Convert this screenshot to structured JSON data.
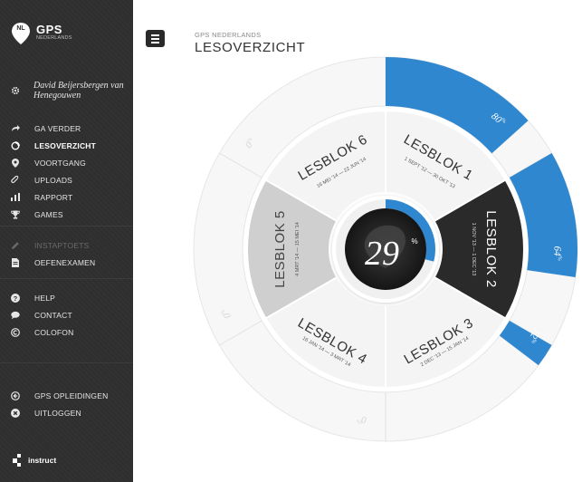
{
  "brand": {
    "badge": "NL",
    "name": "GPS",
    "subtitle": "NEDERLANDS"
  },
  "user": {
    "name": "David Beijersbergen van Henegouwen"
  },
  "nav_main": [
    {
      "label": "GA VERDER",
      "icon": "share-arrow-icon",
      "active": false
    },
    {
      "label": "LESOVERZICHT",
      "icon": "circle-progress-icon",
      "active": true
    },
    {
      "label": "VOORTGANG",
      "icon": "map-pin-icon",
      "active": false
    },
    {
      "label": "UPLOADS",
      "icon": "paperclip-icon",
      "active": false
    },
    {
      "label": "RAPPORT",
      "icon": "bar-chart-icon",
      "active": false
    },
    {
      "label": "GAMES",
      "icon": "trophy-icon",
      "active": false
    }
  ],
  "nav_exam": [
    {
      "label": "INSTAPTOETS",
      "icon": "pencil-icon",
      "disabled": true
    },
    {
      "label": "OEFENEXAMEN",
      "icon": "document-icon",
      "disabled": false
    }
  ],
  "nav_help": [
    {
      "label": "HELP",
      "icon": "question-icon"
    },
    {
      "label": "CONTACT",
      "icon": "chat-bubble-icon"
    },
    {
      "label": "COLOFON",
      "icon": "copyright-icon"
    }
  ],
  "nav_bottom": [
    {
      "label": "GPS OPLEIDINGEN",
      "icon": "arrow-circle-icon"
    },
    {
      "label": "UITLOGGEN",
      "icon": "close-circle-icon"
    }
  ],
  "footer": {
    "label": "instruct"
  },
  "header": {
    "breadcrumb": "GPS NEDERLANDS",
    "title": "LESOVERZICHT"
  },
  "overview": {
    "total_progress": "29",
    "total_progress_unit": "%",
    "colors": {
      "accent": "#2f87d0",
      "dark": "#2a2a2a",
      "mid": "#cfcfcf",
      "light": "#f4f4f4"
    },
    "blocks": [
      {
        "title": "LESBLOK 1",
        "dates": "1 SEPT '12 — 30 OKT '13",
        "progress": 80,
        "progress_label": "80",
        "state": "light"
      },
      {
        "title": "LESBLOK 2",
        "dates": "1 NOV '13 — 1 DEC '13",
        "progress": 64,
        "progress_label": "64",
        "state": "active"
      },
      {
        "title": "LESBLOK 3",
        "dates": "2 DEC '13 — 15 JAN '14",
        "progress": 12,
        "progress_label": "12",
        "state": "light"
      },
      {
        "title": "LESBLOK 4",
        "dates": "16 JAN '14 — 3 MRT '14",
        "progress": 0,
        "progress_label": "0",
        "state": "light"
      },
      {
        "title": "LESBLOK 5",
        "dates": "4 MRT '14 — 15 MEI '14",
        "progress": 0,
        "progress_label": "0",
        "state": "selected"
      },
      {
        "title": "LESBLOK 6",
        "dates": "16 MEI '14 — 22 JUN '14",
        "progress": 0,
        "progress_label": "0",
        "state": "light"
      }
    ]
  }
}
